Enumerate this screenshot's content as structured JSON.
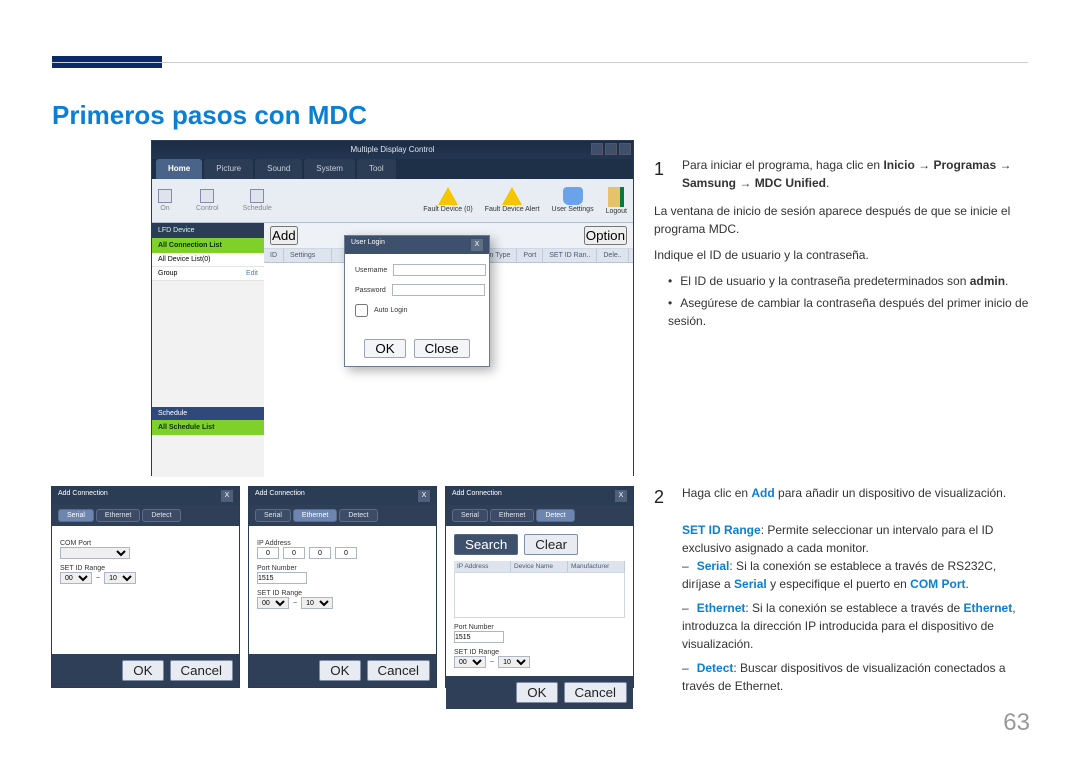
{
  "page": {
    "section_title": "Primeros pasos con MDC",
    "page_number": "63"
  },
  "mdc_main": {
    "title": "Multiple Display Control",
    "tabs": [
      "Home",
      "Picture",
      "Sound",
      "System",
      "Tool"
    ],
    "toolbar_left": [
      "On",
      "Control",
      "Schedule"
    ],
    "toolbar_right": [
      {
        "label": "Fault Device (0)"
      },
      {
        "label": "Fault Device Alert"
      },
      {
        "label": "User Settings"
      },
      {
        "label": "Logout"
      }
    ],
    "center_top": {
      "add": "Add",
      "option": "Option"
    },
    "side": {
      "lfd": "LFD Device",
      "all_conn": "All Connection List",
      "all_dev": "All Device List(0)",
      "group": "Group",
      "edit": "Edit",
      "schedule": "Schedule",
      "all_sched": "All Schedule List"
    },
    "col_headers": [
      "ID",
      "Settings",
      "",
      "",
      "Connection Type",
      "Port",
      "SET ID Ran..",
      "Dele.."
    ],
    "login": {
      "title": "User Login",
      "username": "Username",
      "password": "Password",
      "auto": "Auto Login",
      "ok": "OK",
      "close": "Close"
    }
  },
  "addconn": {
    "title": "Add Connection",
    "tabs": [
      "Serial",
      "Ethernet",
      "Detect"
    ],
    "com_port": "COM Port",
    "set_id": "SET ID Range",
    "range_sep": "~",
    "ip_addr": "IP Address",
    "port_num": "Port Number",
    "port_val": "1515",
    "search": "Search",
    "clear": "Clear",
    "dev_hdr": [
      "IP Address",
      "Device Name",
      "Manufacturer"
    ],
    "ok": "OK",
    "cancel": "Cancel",
    "r0": "00",
    "r1": "10",
    "ip0": "0"
  },
  "instructions": {
    "step1_num": "1",
    "step1_text_a": "Para iniciar el programa, haga clic en ",
    "step1_path_1": "Inicio",
    "step1_arrow": " → ",
    "step1_path_2": "Programas",
    "step1_path_3": "Samsung",
    "step1_path_4": "MDC Unified",
    "step1_period": ".",
    "para1": "La ventana de inicio de sesión aparece después de que se inicie el programa MDC.",
    "para2": "Indique el ID de usuario y la contraseña.",
    "bullet1_a": "El ID de usuario y la contraseña predeterminados son ",
    "bullet1_b": "admin",
    "bullet1_c": ".",
    "bullet2": "Asegúrese de cambiar la contraseña después del primer inicio de sesión.",
    "step2_num": "2",
    "step2_text_a": "Haga clic en ",
    "step2_add": "Add",
    "step2_text_b": " para añadir un dispositivo de visualización.",
    "setid_label": "SET ID Range",
    "setid_text": ": Permite seleccionar un intervalo para el ID exclusivo asignado a cada monitor.",
    "serial_label": "Serial",
    "serial_text_a": ": Si la conexión se establece a través de RS232C, diríjase a ",
    "serial_b": "Serial",
    "serial_text_b": " y especifique el puerto en ",
    "serial_c": "COM Port",
    "eth_label": "Ethernet",
    "eth_text_a": ": Si la conexión se establece a través de ",
    "eth_b": "Ethernet",
    "eth_text_b": ", introduzca la dirección IP introducida para el dispositivo de visualización.",
    "detect_label": "Detect",
    "detect_text": ": Buscar dispositivos de visualización conectados a través de Ethernet."
  }
}
